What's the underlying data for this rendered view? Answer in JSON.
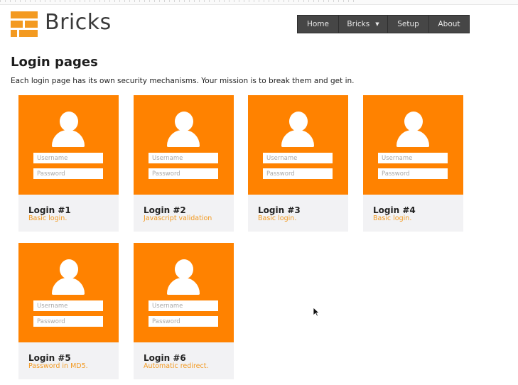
{
  "brand": {
    "name": "Bricks",
    "color": "#f39a21"
  },
  "nav": {
    "items": [
      {
        "label": "Home"
      },
      {
        "label": "Bricks",
        "has_dropdown": true
      },
      {
        "label": "Setup"
      },
      {
        "label": "About"
      }
    ]
  },
  "page": {
    "title": "Login pages",
    "intro": "Each login page has its own security mechanisms. Your mission is to break them and get in."
  },
  "form": {
    "username_placeholder": "Username",
    "password_placeholder": "Password"
  },
  "cards": [
    {
      "title": "Login #1",
      "desc": "Basic login."
    },
    {
      "title": "Login #2",
      "desc": "Javascript validation"
    },
    {
      "title": "Login #3",
      "desc": "Basic login."
    },
    {
      "title": "Login #4",
      "desc": "Basic login."
    },
    {
      "title": "Login #5",
      "desc": "Password in MD5."
    },
    {
      "title": "Login #6",
      "desc": "Automatic redirect."
    }
  ],
  "colors": {
    "panel": "#ff8200",
    "accent_text": "#f39a21",
    "navbar": "#464646",
    "card_footer": "#f2f2f4"
  },
  "icons": {
    "user": "user-icon",
    "logo": "bricks-logo-icon",
    "caret": "caret-down-icon"
  }
}
